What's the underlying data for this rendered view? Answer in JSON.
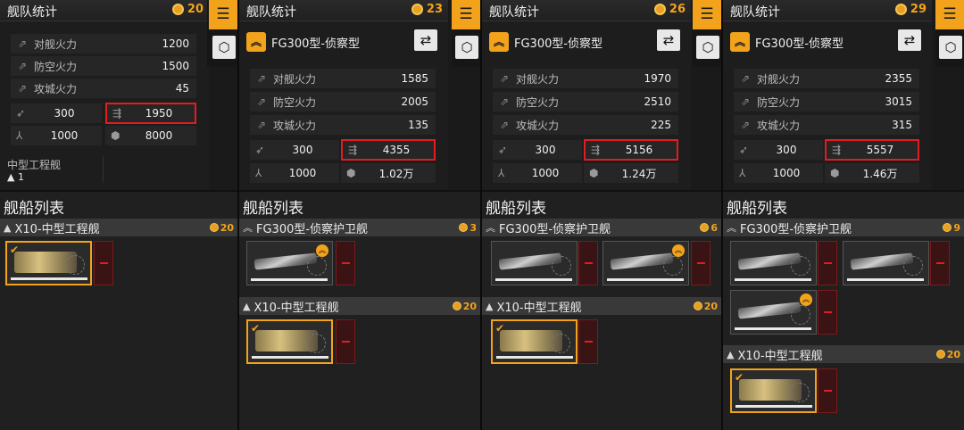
{
  "accent_color": "#f2a31b",
  "highlight_color": "#e21d22",
  "icons": {
    "menu": "list-icon",
    "cube": "cube-icon",
    "swap": "swap-arrows-icon",
    "rank": "chevron-rank-icon",
    "cost": "cost-coin-icon"
  },
  "panels": [
    {
      "title": "舰队统计",
      "cost": "20",
      "ship_name": "",
      "stats": [
        {
          "label": "对舰火力",
          "value": "1200"
        },
        {
          "label": "防空火力",
          "value": "1500"
        },
        {
          "label": "攻城火力",
          "value": "45"
        }
      ],
      "speed": "300",
      "firepower_total": "1950",
      "hp": "1000",
      "capacity": "8000",
      "sub_label": "中型工程舰",
      "sub_count": "1",
      "list_title": "舰船列表",
      "groups": [
        {
          "name": "X10-中型工程舰",
          "cost": "20"
        }
      ]
    },
    {
      "title": "舰队统计",
      "cost": "23",
      "ship_name": "FG300型-侦察型",
      "stats": [
        {
          "label": "对舰火力",
          "value": "1585"
        },
        {
          "label": "防空火力",
          "value": "2005"
        },
        {
          "label": "攻城火力",
          "value": "135"
        }
      ],
      "speed": "300",
      "firepower_total": "4355",
      "hp": "1000",
      "capacity": "1.02万",
      "list_title": "舰船列表",
      "groups": [
        {
          "name": "FG300型-侦察护卫舰",
          "cost": "3"
        },
        {
          "name": "X10-中型工程舰",
          "cost": "20"
        }
      ]
    },
    {
      "title": "舰队统计",
      "cost": "26",
      "ship_name": "FG300型-侦察型",
      "stats": [
        {
          "label": "对舰火力",
          "value": "1970"
        },
        {
          "label": "防空火力",
          "value": "2510"
        },
        {
          "label": "攻城火力",
          "value": "225"
        }
      ],
      "speed": "300",
      "firepower_total": "5156",
      "hp": "1000",
      "capacity": "1.24万",
      "list_title": "舰船列表",
      "groups": [
        {
          "name": "FG300型-侦察护卫舰",
          "cost": "6"
        },
        {
          "name": "X10-中型工程舰",
          "cost": "20"
        }
      ]
    },
    {
      "title": "舰队统计",
      "cost": "29",
      "ship_name": "FG300型-侦察型",
      "stats": [
        {
          "label": "对舰火力",
          "value": "2355"
        },
        {
          "label": "防空火力",
          "value": "3015"
        },
        {
          "label": "攻城火力",
          "value": "315"
        }
      ],
      "speed": "300",
      "firepower_total": "5557",
      "hp": "1000",
      "capacity": "1.46万",
      "list_title": "舰船列表",
      "groups": [
        {
          "name": "FG300型-侦察护卫舰",
          "cost": "9"
        },
        {
          "name": "X10-中型工程舰",
          "cost": "20"
        }
      ]
    }
  ]
}
